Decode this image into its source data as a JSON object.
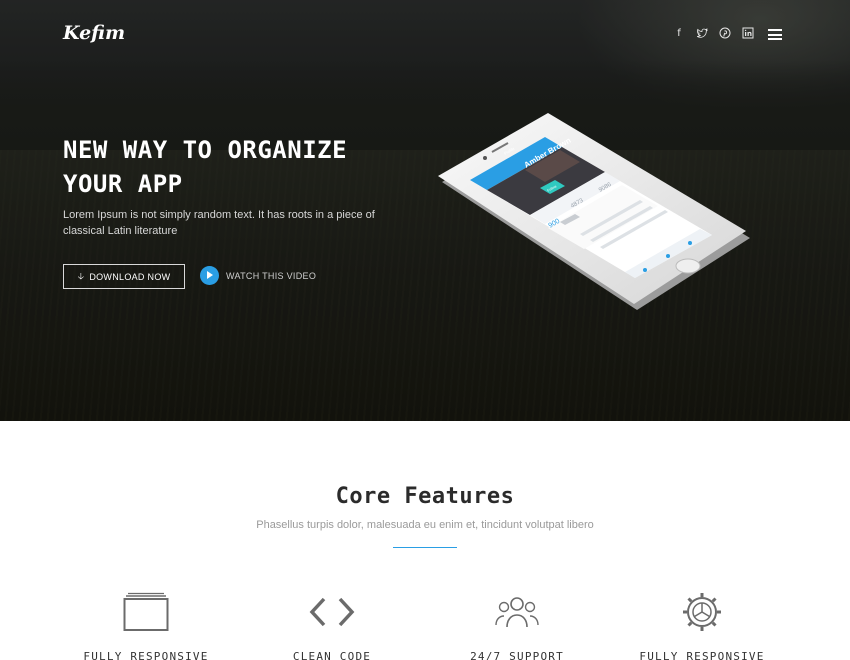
{
  "header": {
    "logo": "Kefim",
    "social": [
      {
        "name": "facebook",
        "glyph": "f"
      },
      {
        "name": "twitter",
        "glyph": "☆"
      },
      {
        "name": "pinterest",
        "glyph": "℗"
      },
      {
        "name": "linkedin",
        "glyph": "in"
      }
    ]
  },
  "hero": {
    "title_line1": "NEW WAY TO ORGANIZE",
    "title_line2": "YOUR APP",
    "subtitle": "Lorem Ipsum is not simply random text. It has roots in a piece of classical Latin literature",
    "download_label": "DOWNLOAD NOW",
    "watch_label": "WATCH THIS VIDEO"
  },
  "phone_screen": {
    "app_title": "Profile",
    "name": "Amber Brown",
    "follow_label": "Follow",
    "stats": [
      "4873",
      "9086",
      "900"
    ]
  },
  "features": {
    "title": "Core Features",
    "subtitle": "Phasellus turpis dolor, malesuada eu enim et, tincidunt volutpat libero",
    "items": [
      {
        "label": "FULLY RESPONSIVE",
        "icon": "window-icon"
      },
      {
        "label": "CLEAN CODE",
        "icon": "code-brackets-icon"
      },
      {
        "label": "24/7 SUPPORT",
        "icon": "people-icon"
      },
      {
        "label": "FULLY RESPONSIVE",
        "icon": "gear-icon"
      }
    ]
  },
  "colors": {
    "accent": "#2a9ee4",
    "hero_dark": "#1d1f1b"
  }
}
